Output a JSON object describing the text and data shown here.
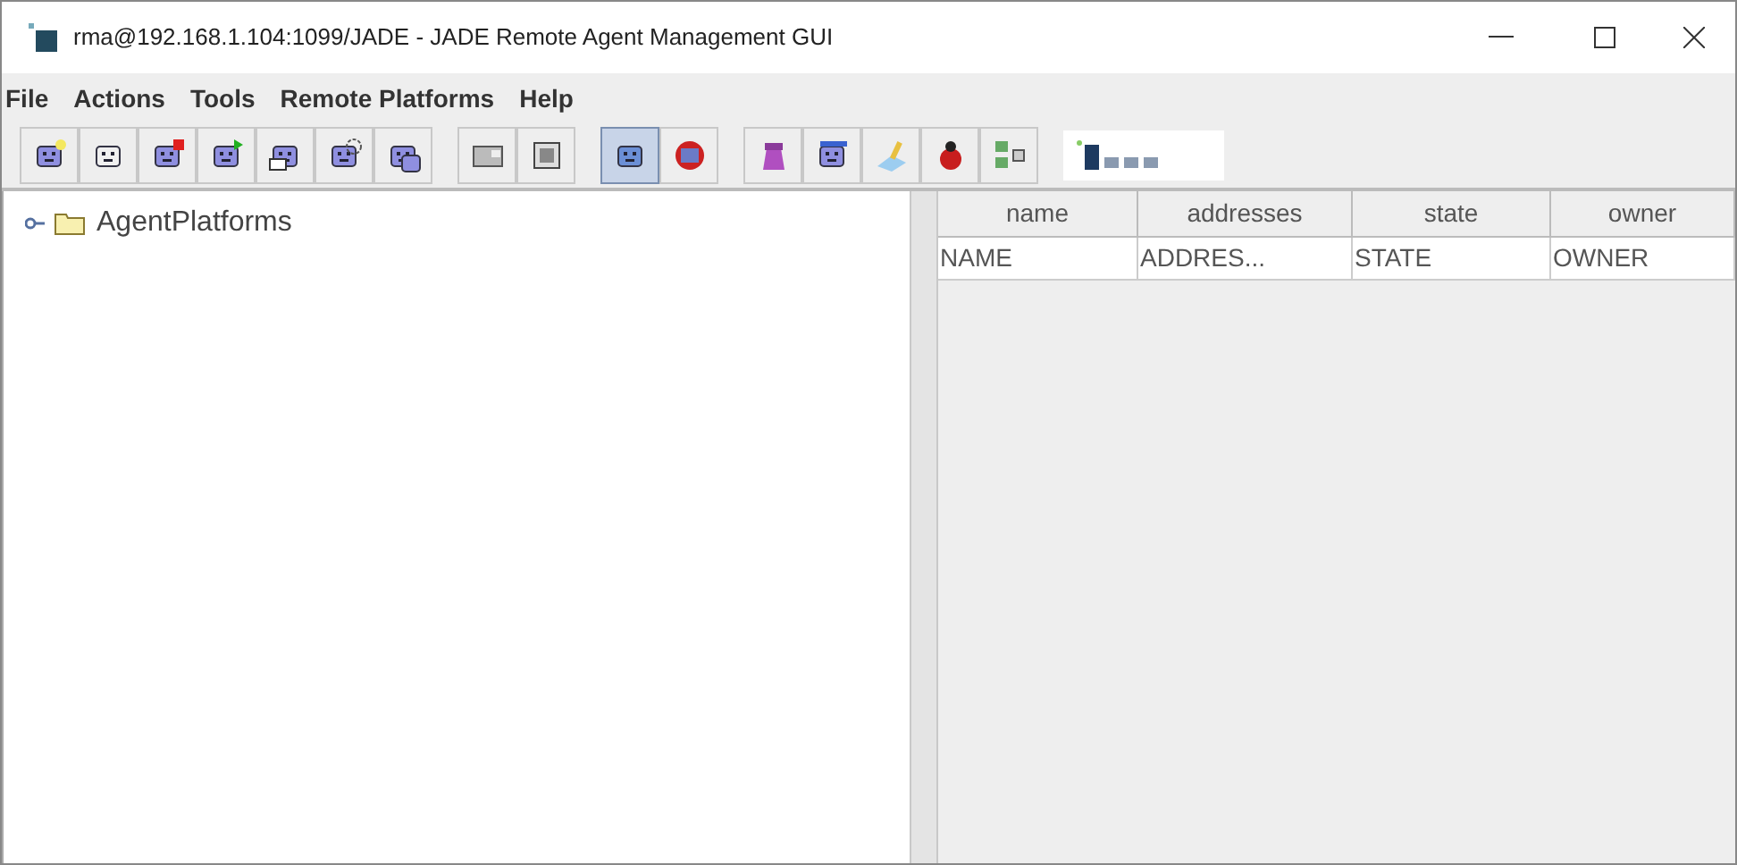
{
  "window": {
    "title": "rma@192.168.1.104:1099/JADE - JADE Remote Agent Management GUI"
  },
  "menu": [
    "File",
    "Actions",
    "Tools",
    "Remote Platforms",
    "Help"
  ],
  "tree": [
    {
      "label": "AgentPlatforms",
      "expanded": false
    }
  ],
  "table": {
    "columns": [
      "name",
      "addresses",
      "state",
      "owner"
    ],
    "rows": [
      [
        "NAME",
        "ADDRES...",
        "STATE",
        "OWNER"
      ]
    ]
  }
}
